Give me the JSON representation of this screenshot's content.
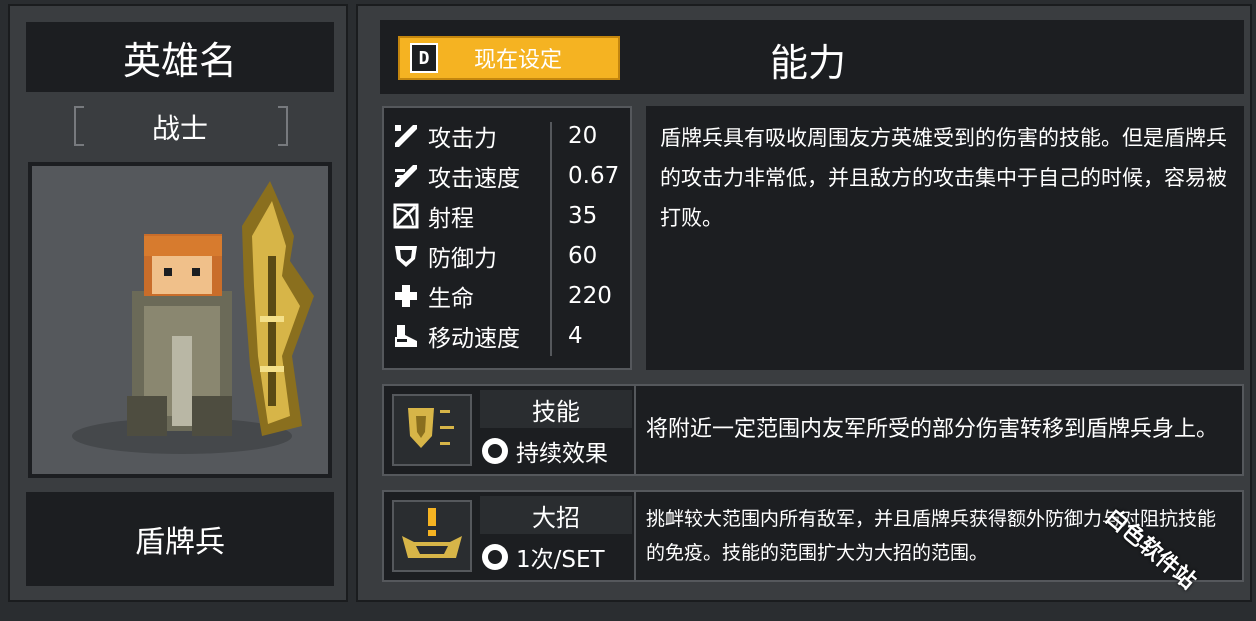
{
  "left": {
    "header": "英雄名",
    "class_label": "战士",
    "hero_type": "盾牌兵"
  },
  "header": {
    "set_button_key": "D",
    "set_button_label": "现在设定",
    "title": "能力"
  },
  "stats": [
    {
      "icon": "sword-icon",
      "label": "攻击力",
      "value": "20"
    },
    {
      "icon": "attack-speed-icon",
      "label": "攻击速度",
      "value": "0.67"
    },
    {
      "icon": "range-icon",
      "label": "射程",
      "value": "35"
    },
    {
      "icon": "shield-icon",
      "label": "防御力",
      "value": "60"
    },
    {
      "icon": "health-cross-icon",
      "label": "生命",
      "value": "220"
    },
    {
      "icon": "boot-icon",
      "label": "移动速度",
      "value": "4"
    }
  ],
  "description": "盾牌兵具有吸收周围友方英雄受到的伤害的技能。但是盾牌兵的攻击力非常低，并且敌方的攻击集中于自己的时候，容易被打败。",
  "skill": {
    "name": "技能",
    "sub": "持续效果",
    "desc": "将附近一定范围内友军所受的部分伤害转移到盾牌兵身上。"
  },
  "ultimate": {
    "name": "大招",
    "sub": "1次/SET",
    "desc": "挑衅较大范围内所有敌军，并且盾牌兵获得额外防御力与对阻抗技能的免疫。技能的范围扩大为大招的范围。"
  },
  "watermark": "白色软件站",
  "colors": {
    "accent": "#f5b322",
    "panel_dark": "#1c1e21",
    "panel": "#3a3d40"
  }
}
